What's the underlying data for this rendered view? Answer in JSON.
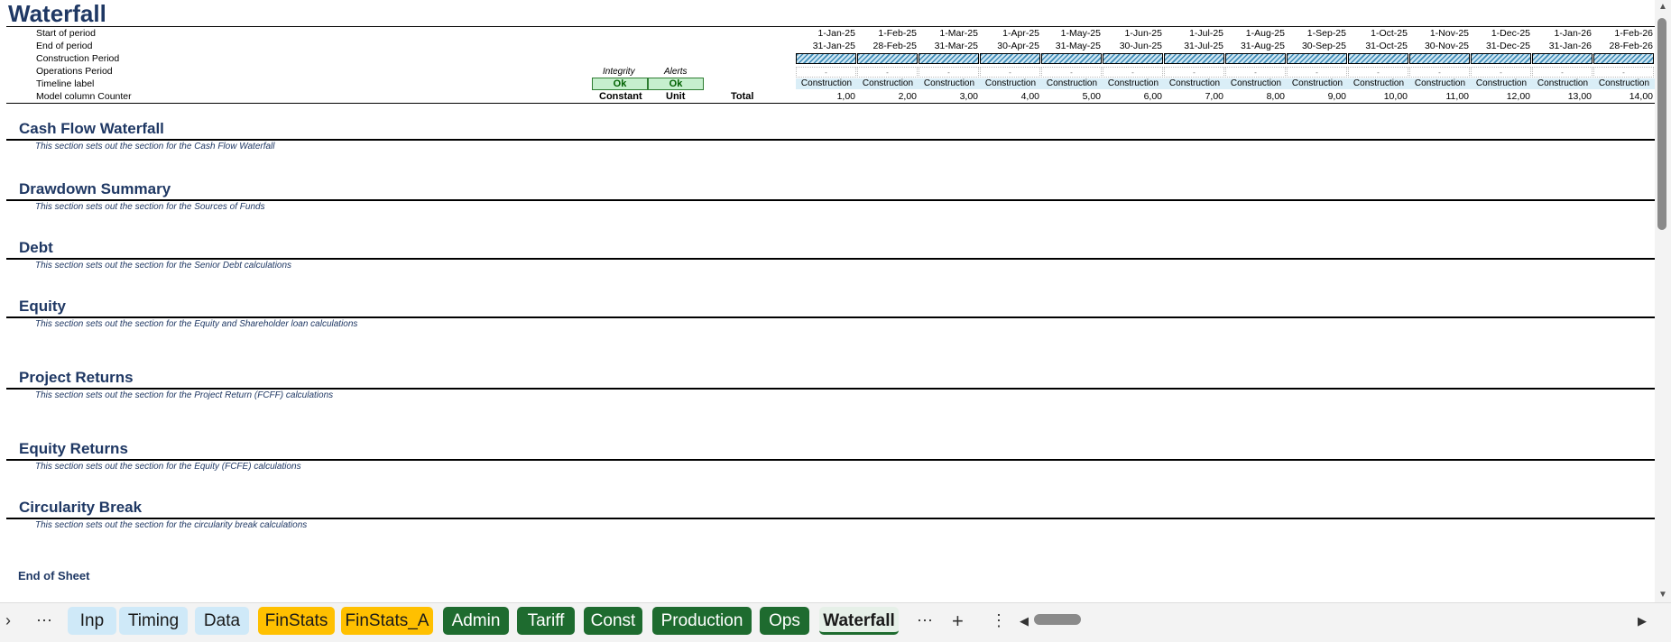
{
  "sheet": {
    "title": "Waterfall",
    "row_labels": [
      "Start of period",
      "End of period",
      "Construction Period",
      "Operations Period",
      "Timeline label",
      "Model column Counter"
    ],
    "integrity_header": "Integrity",
    "alerts_header": "Alerts",
    "integrity_value": "Ok",
    "alerts_value": "Ok",
    "col_constant": "Constant",
    "col_unit": "Unit",
    "col_total": "Total",
    "start_dates": [
      "1-Jan-25",
      "1-Feb-25",
      "1-Mar-25",
      "1-Apr-25",
      "1-May-25",
      "1-Jun-25",
      "1-Jul-25",
      "1-Aug-25",
      "1-Sep-25",
      "1-Oct-25",
      "1-Nov-25",
      "1-Dec-25",
      "1-Jan-26",
      "1-Feb-26"
    ],
    "end_dates": [
      "31-Jan-25",
      "28-Feb-25",
      "31-Mar-25",
      "30-Apr-25",
      "31-May-25",
      "30-Jun-25",
      "31-Jul-25",
      "31-Aug-25",
      "30-Sep-25",
      "31-Oct-25",
      "30-Nov-25",
      "31-Dec-25",
      "31-Jan-26",
      "28-Feb-26"
    ],
    "ops_marker": "-",
    "timeline_labels": [
      "Construction",
      "Construction",
      "Construction",
      "Construction",
      "Construction",
      "Construction",
      "Construction",
      "Construction",
      "Construction",
      "Construction",
      "Construction",
      "Construction",
      "Construction",
      "Construction"
    ],
    "counters": [
      "1,00",
      "2,00",
      "3,00",
      "4,00",
      "5,00",
      "6,00",
      "7,00",
      "8,00",
      "9,00",
      "10,00",
      "11,00",
      "12,00",
      "13,00",
      "14,00"
    ],
    "sections": [
      {
        "title": "Cash Flow Waterfall",
        "desc": "This section sets out the section for the Cash Flow Waterfall"
      },
      {
        "title": "Drawdown Summary",
        "desc": "This section sets out the section for the Sources of Funds"
      },
      {
        "title": "Debt",
        "desc": "This section sets out the section for the Senior Debt calculations"
      },
      {
        "title": "Equity",
        "desc": "This section sets out the section for the Equity and Shareholder loan calculations"
      },
      {
        "title": "Project Returns",
        "desc": "This section sets out the section for the Project Return (FCFF) calculations"
      },
      {
        "title": "Equity Returns",
        "desc": "This section sets out the section for the Equity (FCFE) calculations"
      },
      {
        "title": "Circularity Break",
        "desc": "This section sets out the section for the circularity break calculations"
      }
    ],
    "end_label": "End of Sheet"
  },
  "tabs": {
    "more_left": "⋯",
    "items": [
      {
        "label": "Inp",
        "style": "blue"
      },
      {
        "label": "Timing",
        "style": "blue"
      },
      {
        "label": "Data",
        "style": "blue"
      },
      {
        "label": "FinStats",
        "style": "gold"
      },
      {
        "label": "FinStats_A",
        "style": "gold"
      },
      {
        "label": "Admin",
        "style": "green"
      },
      {
        "label": "Tariff",
        "style": "green"
      },
      {
        "label": "Const",
        "style": "green"
      },
      {
        "label": "Production",
        "style": "green"
      },
      {
        "label": "Ops",
        "style": "green"
      },
      {
        "label": "Waterfall",
        "style": "active"
      }
    ],
    "more_right": "⋯",
    "add": "+",
    "options": "⋮"
  }
}
